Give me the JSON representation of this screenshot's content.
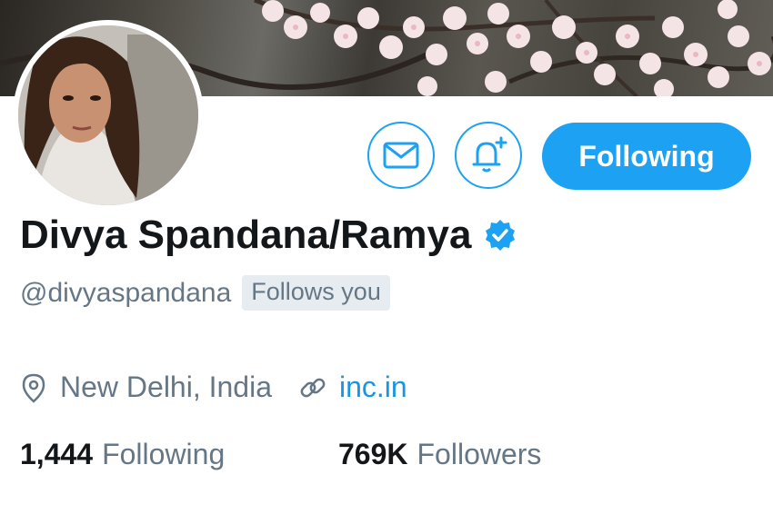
{
  "banner": {
    "description_icon": "cherry-blossom-banner"
  },
  "profile": {
    "display_name": "Divya Spandana/Ramya",
    "handle": "@divyaspandana",
    "follows_you_badge": "Follows you",
    "location": "New Delhi, India",
    "website": "inc.in",
    "verified": true
  },
  "actions": {
    "message_icon": "envelope-icon",
    "notify_icon": "bell-plus-icon",
    "follow_label": "Following"
  },
  "stats": {
    "following_count": "1,444",
    "following_label": "Following",
    "followers_count": "769K",
    "followers_label": "Followers"
  },
  "colors": {
    "accent": "#1da1f2",
    "link": "#1b95e0",
    "text_primary": "#14171a",
    "text_secondary": "#657786",
    "badge_bg": "#e6ecf0"
  }
}
